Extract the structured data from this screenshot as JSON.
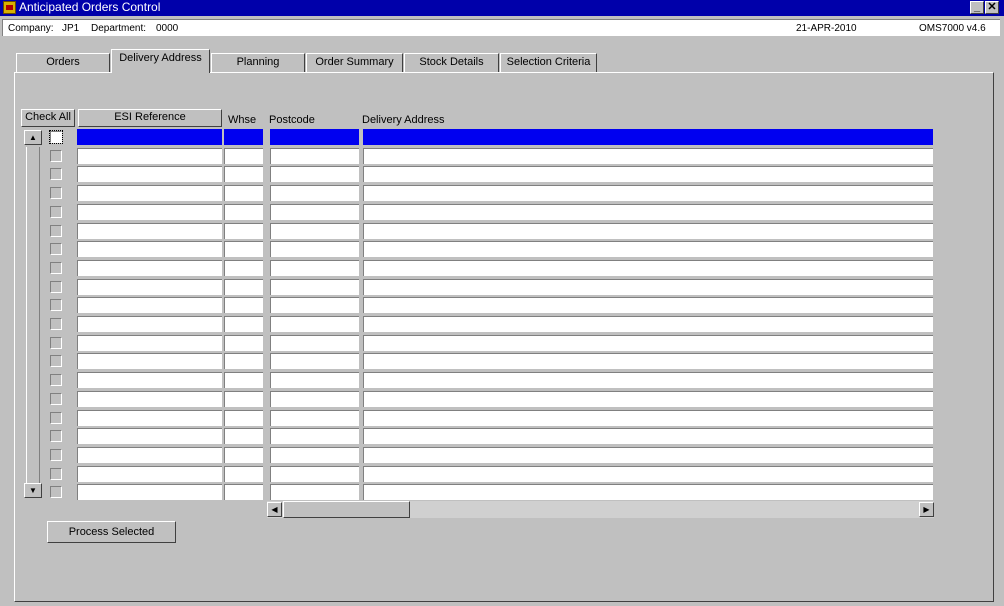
{
  "window": {
    "title": "Anticipated Orders Control",
    "icon": "oracle-forms-app-icon",
    "minimize_label": "_",
    "close_label": "✕"
  },
  "infobar": {
    "company_label": "Company:",
    "company": "JP1",
    "department_label": "Department:",
    "department": "0000",
    "date": "21-APR-2010",
    "version": "OMS7000  v4.6"
  },
  "tabs": [
    {
      "label": "Orders",
      "active": false
    },
    {
      "label": "Delivery Address",
      "active": true
    },
    {
      "label": "Planning",
      "active": false
    },
    {
      "label": "Order Summary",
      "active": false
    },
    {
      "label": "Stock Details",
      "active": false
    },
    {
      "label": "Selection Criteria",
      "active": false
    }
  ],
  "grid": {
    "check_all_label": "Check All",
    "esi_reference_label": "ESI Reference",
    "whse_label": "Whse",
    "postcode_label": "Postcode",
    "delivery_address_label": "Delivery Address",
    "row_count": 20,
    "selected_row": 0,
    "rows_checked": [
      false,
      false,
      false,
      false,
      false,
      false,
      false,
      false,
      false,
      false,
      false,
      false,
      false,
      false,
      false,
      false,
      false,
      false,
      false,
      false
    ]
  },
  "scroll": {
    "up_icon": "▲",
    "down_icon": "▼",
    "left_icon": "◀",
    "right_icon": "▶"
  },
  "actions": {
    "process_selected_label": "Process Selected"
  }
}
